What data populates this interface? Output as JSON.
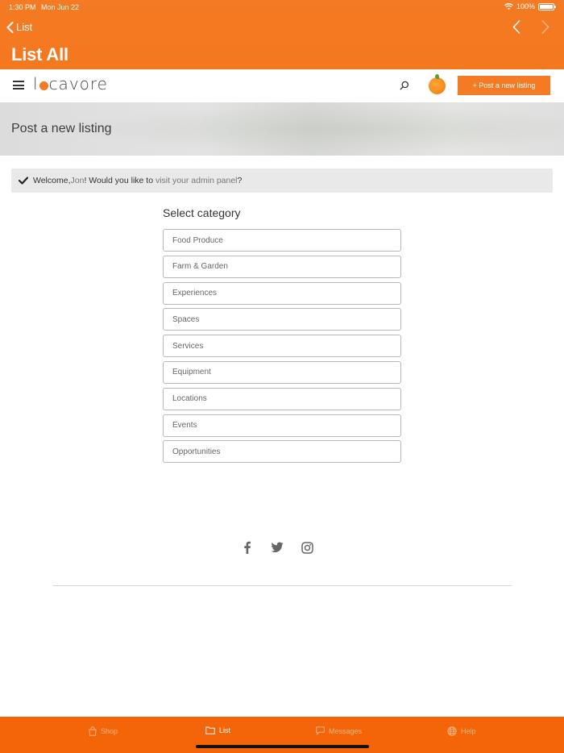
{
  "status": {
    "time": "1:30 PM",
    "date": "Mon Jun 22",
    "battery": "100%"
  },
  "header": {
    "back_label": "List",
    "title": "List All"
  },
  "site": {
    "logo_text_left": "l",
    "logo_text_right": "cavore",
    "post_button": "+ Post a new listing",
    "brand_color": "#f47a23"
  },
  "hero": {
    "title": "Post a new listing"
  },
  "welcome": {
    "prefix": "Welcome, ",
    "name": "Jon",
    "middle": "! Would you like to ",
    "link": "visit your admin panel",
    "suffix": "?"
  },
  "form": {
    "heading": "Select category",
    "categories": [
      "Food Produce",
      "Farm & Garden",
      "Experiences",
      "Spaces",
      "Services",
      "Equipment",
      "Locations",
      "Events",
      "Opportunities"
    ]
  },
  "social": [
    "facebook-icon",
    "twitter-icon",
    "instagram-icon"
  ],
  "tabs": [
    {
      "label": "Shop",
      "icon": "bag-icon"
    },
    {
      "label": "List",
      "icon": "folder-icon",
      "active": true
    },
    {
      "label": "Messages",
      "icon": "chat-icon"
    },
    {
      "label": "Help",
      "icon": "globe-icon"
    }
  ]
}
